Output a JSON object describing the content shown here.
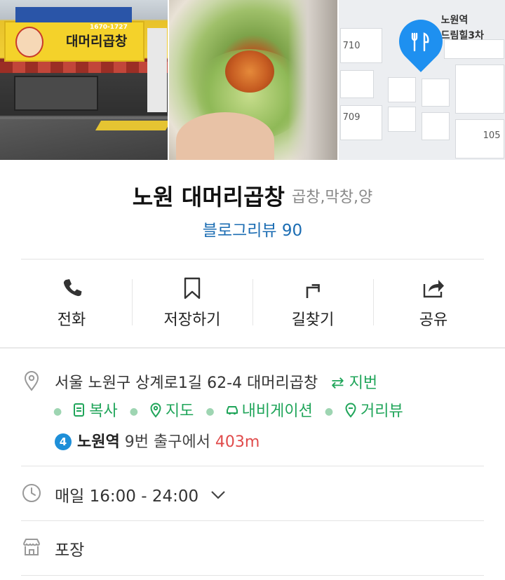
{
  "photos": {
    "storefront_sign": "대머리곱창",
    "storefront_phone": "1670-1727",
    "map": {
      "place_label_line1": "노원역",
      "place_label_line2": "드림힐3차",
      "lot_710": "710",
      "lot_709": "709",
      "lot_105": "105"
    }
  },
  "place": {
    "name": "노원 대머리곱창",
    "category": "곱창,막창,양",
    "blog_review": "블로그리뷰 90"
  },
  "actions": [
    {
      "label": "전화",
      "icon": "phone-icon"
    },
    {
      "label": "저장하기",
      "icon": "bookmark-icon"
    },
    {
      "label": "길찾기",
      "icon": "directions-icon"
    },
    {
      "label": "공유",
      "icon": "share-icon"
    }
  ],
  "address": {
    "text": "서울 노원구 상계로1길 62-4 대머리곱창",
    "toggle": "⇄ 지번",
    "links": [
      {
        "label": "복사",
        "icon": "copy-icon"
      },
      {
        "label": "지도",
        "icon": "map-pin-icon"
      },
      {
        "label": "내비게이션",
        "icon": "car-icon"
      },
      {
        "label": "거리뷰",
        "icon": "street-view-icon"
      }
    ]
  },
  "subway": {
    "line": "4",
    "station": "노원역",
    "exit_text": " 9번 출구에서 ",
    "distance": "403m"
  },
  "hours": {
    "text": "매일 16:00 - 24:00"
  },
  "service": {
    "text": "포장"
  },
  "colors": {
    "green": "#20a55a",
    "link_blue": "#1c6db3",
    "distance_red": "#e04b4b",
    "line4_blue": "#1e8fd8",
    "pin_blue": "#1e90f0"
  }
}
